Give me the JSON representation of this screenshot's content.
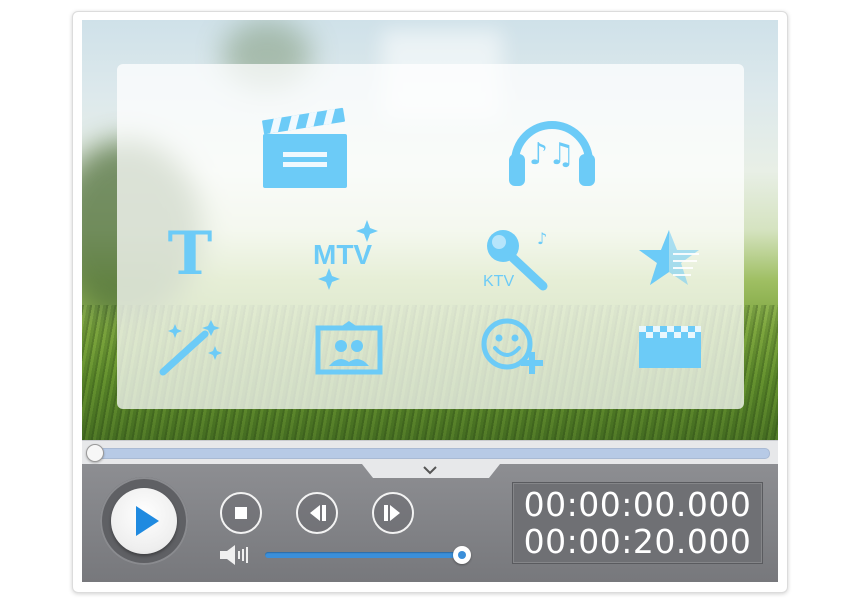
{
  "preview": {
    "tools": [
      {
        "name": "clapperboard-icon",
        "label": ""
      },
      {
        "name": "headphones-music-icon",
        "label": ""
      },
      {
        "name": "text-icon",
        "label": "T"
      },
      {
        "name": "mtv-icon",
        "label": "MTV"
      },
      {
        "name": "ktv-microphone-icon",
        "label": "KTV"
      },
      {
        "name": "star-icon",
        "label": ""
      },
      {
        "name": "magic-wand-icon",
        "label": ""
      },
      {
        "name": "photo-frame-icon",
        "label": ""
      },
      {
        "name": "add-emoji-icon",
        "label": ""
      },
      {
        "name": "checkered-flag-icon",
        "label": ""
      }
    ]
  },
  "seekbar": {
    "progress": 0.0
  },
  "controls": {
    "play_icon": "play-icon",
    "stop_icon": "stop-icon",
    "prev_frame_icon": "previous-frame-icon",
    "next_frame_icon": "next-frame-icon",
    "volume_icon": "speaker-icon",
    "volume_level": 1.0,
    "chevron_icon": "chevron-down-icon"
  },
  "time": {
    "current": "00:00:00.000",
    "total": "00:00:20.000"
  },
  "colors": {
    "icon_blue": "#6ccbf7",
    "accent_blue": "#3b8fd9",
    "play_blue": "#1f8ae0",
    "control_bar": "#838488"
  }
}
